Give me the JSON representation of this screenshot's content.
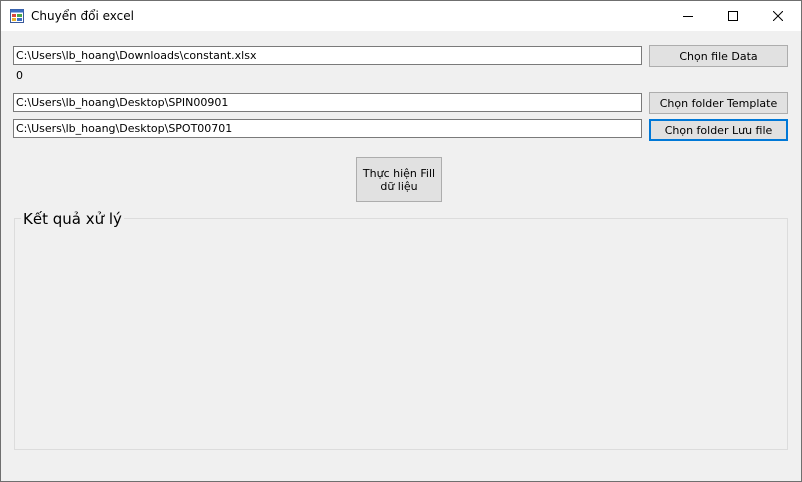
{
  "window": {
    "title": "Chuyển đổi excel"
  },
  "data_file": {
    "path": "C:\\Users\\lb_hoang\\Downloads\\constant.xlsx",
    "button_label": "Chọn file Data",
    "count_label": "0"
  },
  "template_folder": {
    "path": "C:\\Users\\lb_hoang\\Desktop\\SPIN00901",
    "button_label": "Chọn folder Template"
  },
  "save_folder": {
    "path": "C:\\Users\\lb_hoang\\Desktop\\SPOT00701",
    "button_label": "Chọn folder Lưu file"
  },
  "run_button": {
    "line1": "Thực hiện Fill",
    "line2": "dữ liệu"
  },
  "results": {
    "title": "Kết quả xử lý"
  },
  "icons": {
    "app": "app-window-icon",
    "minimize": "minimize-icon",
    "maximize": "maximize-icon",
    "close": "close-icon"
  },
  "colors": {
    "window_bg": "#f0f0f0",
    "button_bg": "#e1e1e1",
    "focus_border": "#0078d7"
  }
}
